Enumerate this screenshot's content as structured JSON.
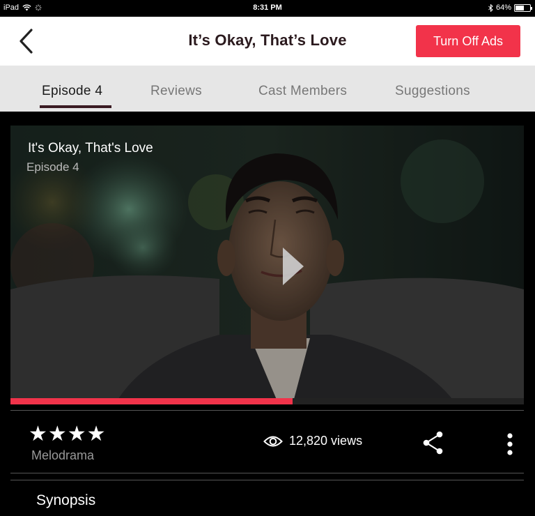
{
  "status_bar": {
    "device": "iPad",
    "time": "8:31 PM",
    "battery": "64%",
    "battery_level": 0.64
  },
  "header": {
    "title": "It’s Okay, That’s Love",
    "ads_button": "Turn Off Ads",
    "accent": "#f2334a"
  },
  "tabs": [
    {
      "label": "Episode 4",
      "active": true
    },
    {
      "label": "Reviews",
      "active": false
    },
    {
      "label": "Cast Members",
      "active": false
    },
    {
      "label": "Suggestions",
      "active": false
    }
  ],
  "video": {
    "title": "It's Okay, That's Love",
    "subtitle": "Episode 4",
    "progress": 0.55
  },
  "info": {
    "rating": 4,
    "stars": "★★★★",
    "genre": "Melodrama",
    "views": "12,820 views"
  },
  "synopsis": {
    "heading": "Synopsis"
  },
  "icons": [
    "back-chevron-icon",
    "wifi-icon",
    "activity-spinner-icon",
    "bluetooth-icon",
    "battery-icon",
    "play-icon",
    "eye-icon",
    "share-icon",
    "more-vertical-icon"
  ]
}
